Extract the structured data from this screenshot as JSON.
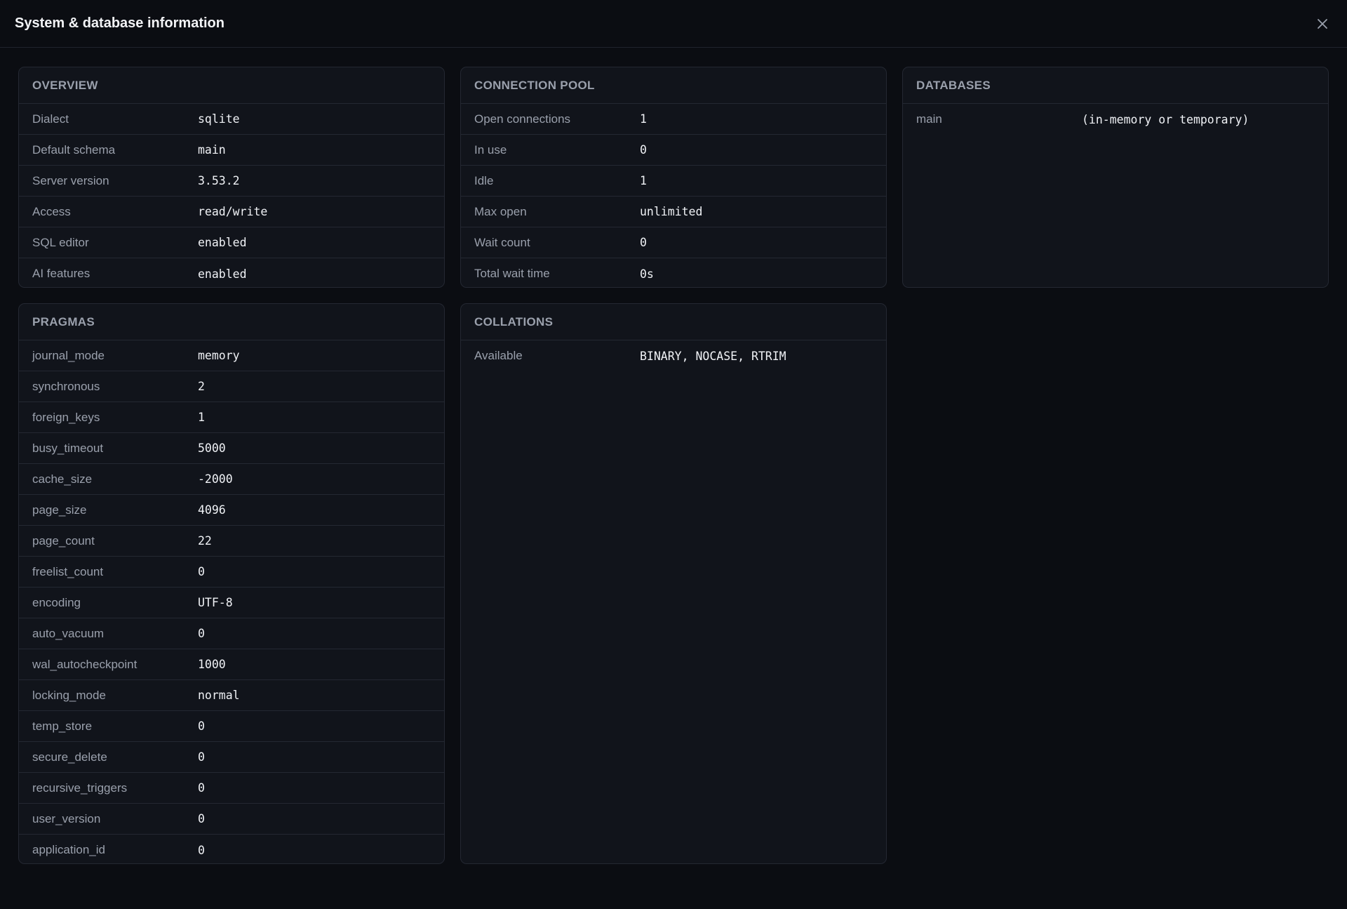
{
  "header": {
    "title": "System & database information",
    "close_icon": "close-icon"
  },
  "overview": {
    "title": "OVERVIEW",
    "rows": [
      {
        "label": "Dialect",
        "value": "sqlite"
      },
      {
        "label": "Default schema",
        "value": "main"
      },
      {
        "label": "Server version",
        "value": "3.53.2"
      },
      {
        "label": "Access",
        "value": "read/write"
      },
      {
        "label": "SQL editor",
        "value": "enabled"
      },
      {
        "label": "AI features",
        "value": "enabled"
      }
    ]
  },
  "pool": {
    "title": "CONNECTION POOL",
    "rows": [
      {
        "label": "Open connections",
        "value": "1"
      },
      {
        "label": "In use",
        "value": "0"
      },
      {
        "label": "Idle",
        "value": "1"
      },
      {
        "label": "Max open",
        "value": "unlimited"
      },
      {
        "label": "Wait count",
        "value": "0"
      },
      {
        "label": "Total wait time",
        "value": "0s"
      }
    ]
  },
  "databases": {
    "title": "DATABASES",
    "rows": [
      {
        "label": "main",
        "value": "(in-memory or temporary)"
      }
    ]
  },
  "pragmas": {
    "title": "PRAGMAS",
    "rows": [
      {
        "label": "journal_mode",
        "value": "memory"
      },
      {
        "label": "synchronous",
        "value": "2"
      },
      {
        "label": "foreign_keys",
        "value": "1"
      },
      {
        "label": "busy_timeout",
        "value": "5000"
      },
      {
        "label": "cache_size",
        "value": "-2000"
      },
      {
        "label": "page_size",
        "value": "4096"
      },
      {
        "label": "page_count",
        "value": "22"
      },
      {
        "label": "freelist_count",
        "value": "0"
      },
      {
        "label": "encoding",
        "value": "UTF-8"
      },
      {
        "label": "auto_vacuum",
        "value": "0"
      },
      {
        "label": "wal_autocheckpoint",
        "value": "1000"
      },
      {
        "label": "locking_mode",
        "value": "normal"
      },
      {
        "label": "temp_store",
        "value": "0"
      },
      {
        "label": "secure_delete",
        "value": "0"
      },
      {
        "label": "recursive_triggers",
        "value": "0"
      },
      {
        "label": "user_version",
        "value": "0"
      },
      {
        "label": "application_id",
        "value": "0"
      }
    ]
  },
  "collations": {
    "title": "COLLATIONS",
    "rows": [
      {
        "label": "Available",
        "value": "BINARY, NOCASE, RTRIM"
      }
    ]
  }
}
